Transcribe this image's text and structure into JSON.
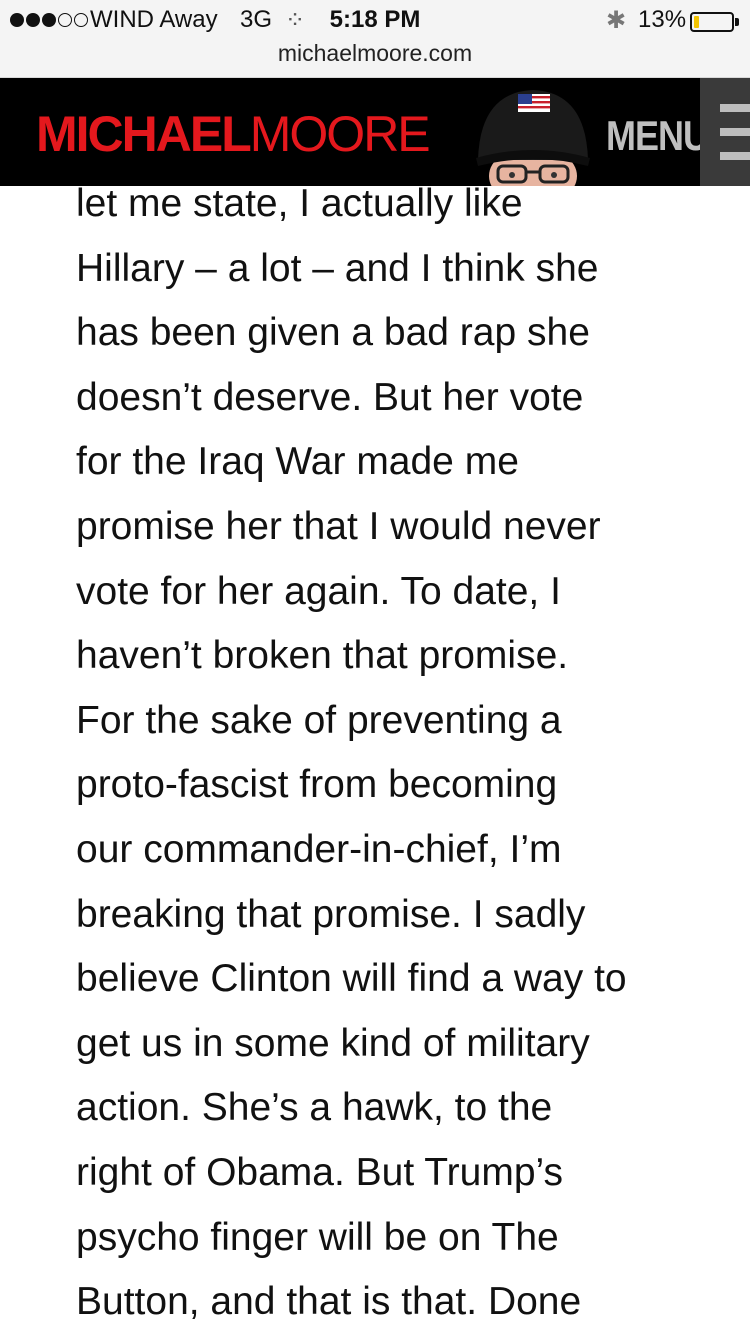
{
  "status_bar": {
    "signal_filled": 3,
    "signal_total": 5,
    "carrier": "WIND Away",
    "network": "3G",
    "time": "5:18 PM",
    "battery_percent_text": "13%",
    "battery_level": 0.13,
    "battery_color": "#f4c400"
  },
  "browser": {
    "url": "michaelmoore.com"
  },
  "site_header": {
    "logo_first": "MICHAEL",
    "logo_last": "MOORE",
    "logo_color": "#e4181d",
    "menu_label": "MENU",
    "background": "#000000"
  },
  "article": {
    "lines": [
      "let me state, I actually like",
      "Hillary – a lot – and I think she",
      "has been given a bad rap she",
      "doesn’t deserve. But her vote",
      "for the Iraq War made me",
      "promise her that I would never",
      "vote for her again. To date, I",
      "haven’t broken that promise.",
      "For the sake of preventing a",
      "proto-fascist from becoming",
      "our commander-in-chief, I’m",
      "breaking that promise. I sadly",
      "believe Clinton will find a way to",
      "get us in some kind of military",
      "action. She’s a hawk, to the",
      "right of Obama. But Trump’s",
      "psycho finger will be on The",
      "Button, and that is that. Done"
    ]
  }
}
